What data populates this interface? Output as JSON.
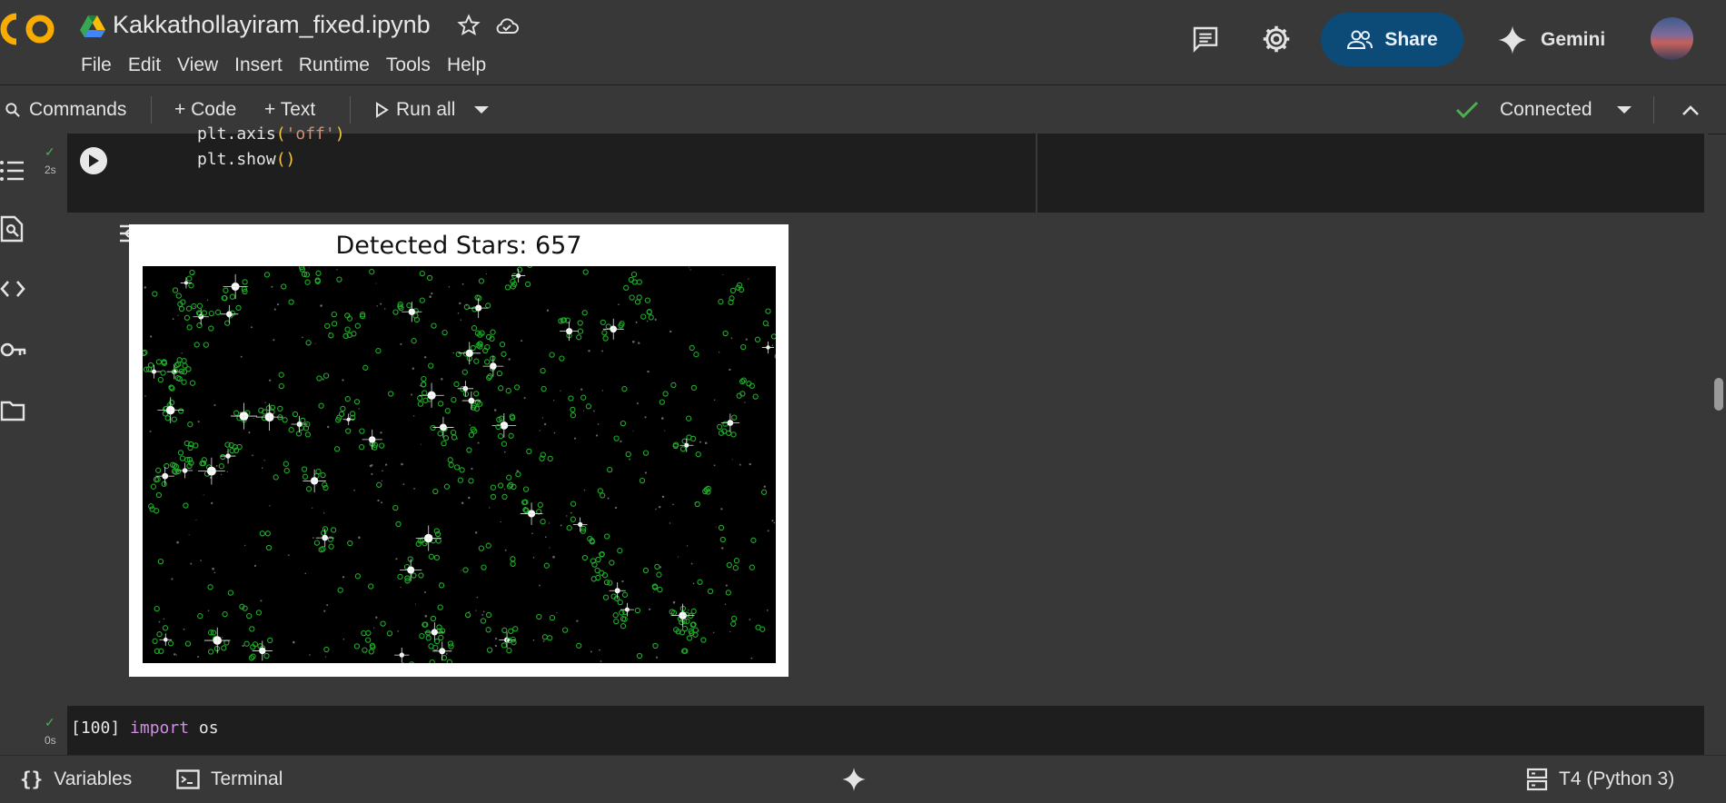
{
  "header": {
    "title": "Kakkathollayiram_fixed.ipynb",
    "logo_text": "CO",
    "menu": [
      "File",
      "Edit",
      "View",
      "Insert",
      "Runtime",
      "Tools",
      "Help"
    ],
    "share_label": "Share",
    "gemini_label": "Gemini"
  },
  "toolbar": {
    "commands_label": "Commands",
    "code_label": "+ Code",
    "text_label": "+ Text",
    "run_all_label": "Run all",
    "connection_status": "Connected"
  },
  "cells": [
    {
      "exec_check": "✓",
      "exec_time": "2s",
      "code_line_1": "plt.axis('off')",
      "code_line_1_parts": [
        "plt.axis",
        "(",
        "'off'",
        ")"
      ],
      "code_line_2_parts": [
        "plt.show",
        "()",
        ""
      ],
      "output": {
        "plot_title": "Detected Stars: 657"
      }
    },
    {
      "exec_check": "✓",
      "exec_time": "0s",
      "exec_count": "[100]",
      "code_keyword": "import",
      "code_rest": " os"
    }
  ],
  "statusbar": {
    "variables_label": "Variables",
    "terminal_label": "Terminal",
    "runtime_label": "T4 (Python 3)"
  },
  "colors": {
    "background": "#383838",
    "cell_background": "#1e1e1e",
    "share_button": "#0c4a78",
    "connected_check": "#4caf50",
    "detection_circles": "#1fae2a"
  },
  "icons": [
    "drive-icon",
    "star-icon",
    "cloud-icon",
    "comment-icon",
    "settings-icon",
    "people-icon",
    "gemini-icon",
    "search-icon",
    "play-icon",
    "chevron-down-icon",
    "check-icon",
    "chevron-up-icon",
    "toc-icon",
    "find-icon",
    "code-icon",
    "key-icon",
    "folder-icon",
    "run-cell-icon",
    "output-toggle-icon",
    "braces-icon",
    "terminal-icon",
    "sparkle-icon",
    "server-icon"
  ]
}
